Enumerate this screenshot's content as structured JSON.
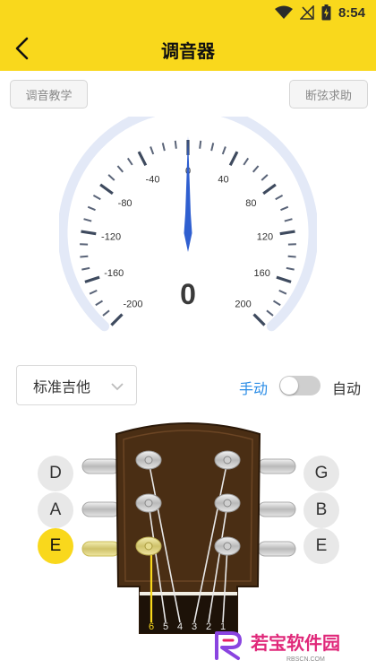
{
  "status_bar": {
    "time": "8:54"
  },
  "header": {
    "title": "调音器"
  },
  "buttons": {
    "tutorial": "调音教学",
    "string_help": "断弦求助"
  },
  "gauge": {
    "labels": [
      "-200",
      "-160",
      "-120",
      "-80",
      "-40",
      "0",
      "40",
      "80",
      "120",
      "160",
      "200"
    ],
    "needle_value": 0,
    "readout": "0"
  },
  "controls": {
    "tuning": "标准吉他",
    "mode_manual": "手动",
    "mode_auto": "自动",
    "auto_enabled": false
  },
  "strings": {
    "left_notes": [
      "D",
      "A",
      "E"
    ],
    "right_notes": [
      "G",
      "B",
      "E"
    ],
    "active_note": "E",
    "nut_numbers": [
      "6",
      "5",
      "4",
      "3",
      "2",
      "1"
    ]
  },
  "watermark": {
    "brand": "若宝软件园",
    "url": "RBSCN.COM"
  },
  "colors": {
    "accent": "#f9d81c",
    "needle": "#2f5fd0",
    "link": "#2a8ce6",
    "headstock": "#4a2e14"
  }
}
